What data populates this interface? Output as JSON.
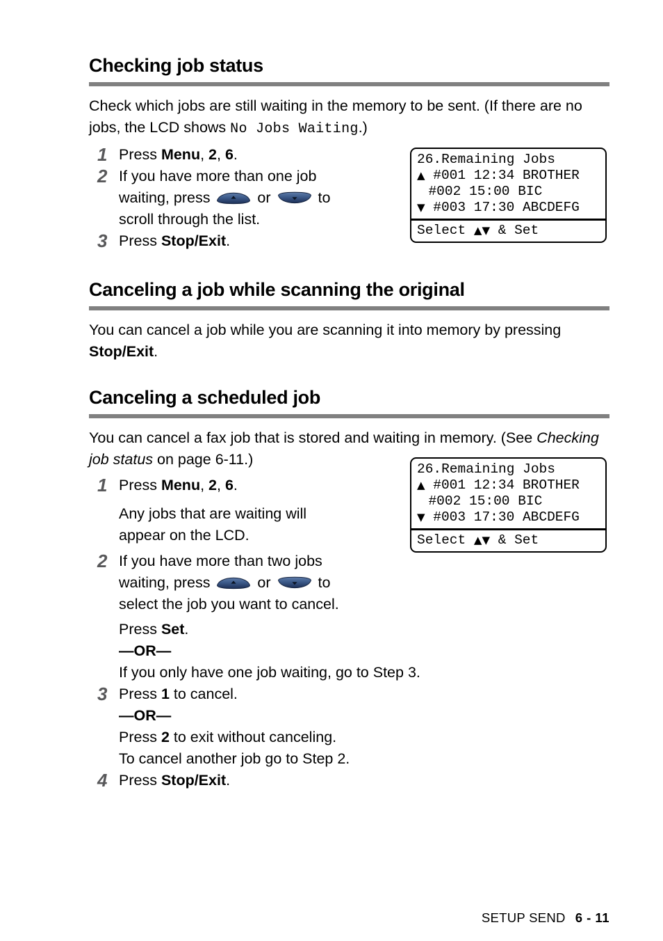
{
  "page": {
    "footer_label": "SETUP SEND",
    "footer_page": "6 - 11"
  },
  "colors": {
    "heading_rule": "#808080",
    "step_number": "#58585a",
    "navkey_blue": "#3b5887",
    "navkey_blue_dark": "#22365c"
  },
  "sections": [
    {
      "heading": "Checking job status",
      "intro_a": "Check which jobs are still waiting in the memory to be sent. (If there are no jobs, the LCD shows ",
      "intro_mono": "No Jobs Waiting",
      "intro_b": ".)",
      "steps": {
        "s1_num": "1",
        "s1_press": "Press ",
        "s1_menu": "Menu",
        "s1_sep1": ", ",
        "s1_key2": "2",
        "s1_sep2": ", ",
        "s1_key6": "6",
        "s1_end": ".",
        "s2_num": "2",
        "s2_line1": "If you have more than one job",
        "s2_line2a": "waiting, press ",
        "s2_or": " or ",
        "s2_line2b": " to",
        "s2_line3": "scroll through the list.",
        "s3_num": "3",
        "s3_press": "Press ",
        "s3_stopexit": "Stop/Exit",
        "s3_end": "."
      }
    },
    {
      "heading": "Canceling a job while scanning the original",
      "body_a": "You can cancel a job while you are scanning it into memory by pressing ",
      "body_bold": "Stop/Exit",
      "body_b": "."
    },
    {
      "heading": "Canceling a scheduled job",
      "body_a": "You can cancel a fax job that is stored and waiting in memory. (See ",
      "body_italic": "Checking job status",
      "body_b": " on page 6-11.)",
      "steps": {
        "s1_num": "1",
        "s1_press": "Press ",
        "s1_menu": "Menu",
        "s1_sep1": ", ",
        "s1_key2": "2",
        "s1_sep2": ", ",
        "s1_key6": "6",
        "s1_end": ".",
        "s1_sub1": "Any jobs that are waiting will",
        "s1_sub2": "appear on the LCD.",
        "s2_num": "2",
        "s2_line1": "If you have more than two jobs",
        "s2_line2a": "waiting, press ",
        "s2_or": " or ",
        "s2_line2b": " to",
        "s2_line3": "select the job you want to cancel.",
        "s2_press_set_a": "Press ",
        "s2_press_set_b": "Set",
        "s2_press_set_c": ".",
        "s2_or_rule": "—OR—",
        "s2_alt": "If you only have one job waiting, go to Step 3.",
        "s3_num": "3",
        "s3_press_a": "Press ",
        "s3_key1": "1",
        "s3_press_b": " to cancel.",
        "s3_or_rule": "—OR—",
        "s3_alt_a": "Press ",
        "s3_key2": "2",
        "s3_alt_b": " to exit without canceling.",
        "s3_alt2": "To cancel another job go to Step 2.",
        "s4_num": "4",
        "s4_press": "Press ",
        "s4_stopexit": "Stop/Exit",
        "s4_end": "."
      }
    }
  ],
  "lcd": {
    "line1": "26.Remaining Jobs",
    "line2_arrow": "▲",
    "line2": " #001 12:34 BROTHER",
    "line3_arrow": " ",
    "line3": " #002 15:00 BIC",
    "line4_arrow": "▼",
    "line4": " #003 17:30 ABCDEFG",
    "status_a": "Select ",
    "status_arrows": "▲▼",
    "status_b": " & Set"
  }
}
